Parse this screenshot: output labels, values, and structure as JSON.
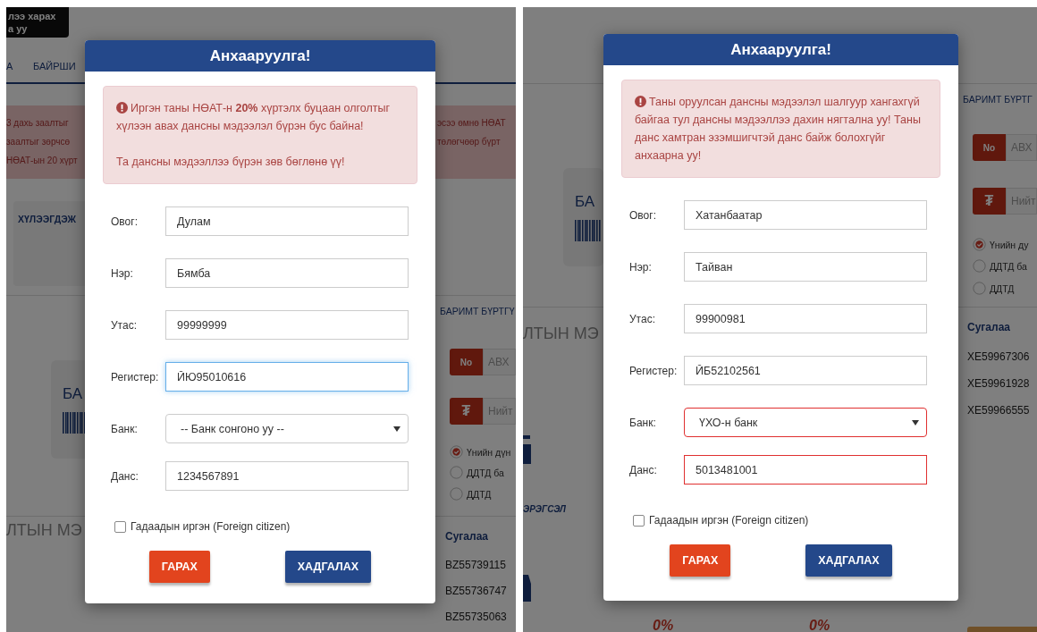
{
  "panels": [
    {
      "background": {
        "tooltip": [
          "лээ харах",
          "а уу"
        ],
        "nav": [
          "А",
          "БАЙРШИ"
        ],
        "notice_left": [
          "3 дахь заалтыг",
          "заалтыг  зөрчсө",
          "НӨАТ-ын 20 хүрт"
        ],
        "notice_right": [
          "эсээ өмнө НӨАТ",
          "төлөгчөөр  бүрт"
        ],
        "pending_card": "ХҮЛЭЭГДЭЖ",
        "receipt": "БА",
        "heading": "ЛТЫН МЭ",
        "side": {
          "title": "БАРИМТ БҮРТГҮ",
          "number_prefix": "No",
          "number_placeholder": "АВХ",
          "currency": "₮",
          "amount_placeholder": "Нийт",
          "options": [
            {
              "label": "Үнийн дүн",
              "selected": true
            },
            {
              "label": "ДДТД ба",
              "selected": false
            },
            {
              "label": "ДДТД",
              "selected": false
            }
          ],
          "lottery_header": "Сугалаа",
          "lottery": [
            "BZ55739115",
            "BZ55736747",
            "BZ55735063"
          ]
        }
      },
      "modal": {
        "title": "Анхааруулга!",
        "alert": [
          "Иргэн таны НӨАТ-н **20%** хүртэлх буцаан олголтыг хүлээн авах дансны мэдээлэл бүрэн бус байна!",
          "Та дансны мэдээллээ бүрэн зөв бөглөнө үү!"
        ],
        "fields": [
          {
            "kind": "text",
            "label": "Овог:",
            "value": "Дулам",
            "focused": false,
            "invalid": false
          },
          {
            "kind": "text",
            "label": "Нэр:",
            "value": "Бямба",
            "focused": false,
            "invalid": false
          },
          {
            "kind": "text",
            "label": "Утас:",
            "value": "99999999",
            "focused": false,
            "invalid": false
          },
          {
            "kind": "text",
            "label": "Регистер:",
            "value": "ЙЮ95010616",
            "focused": true,
            "invalid": false
          },
          {
            "kind": "select",
            "label": "Банк:",
            "value": "-- Банк сонгоно уу --",
            "focused": false,
            "invalid": false
          },
          {
            "kind": "text",
            "label": "Данс:",
            "value": "1234567891",
            "focused": false,
            "invalid": false
          }
        ],
        "checkbox": {
          "label": "Гадаадын иргэн (Foreign citizen)",
          "checked": false
        },
        "buttons": [
          {
            "kind": "cancel",
            "label": "ГАРАХ"
          },
          {
            "kind": "save",
            "label": "ХАДГАЛАХ"
          }
        ]
      }
    },
    {
      "background": {
        "receipt": "БА",
        "heading": "ЛТЫН МЭ",
        "category": "ЭРЭГСЭЛ",
        "percents": [
          "0%",
          "0%"
        ],
        "side": {
          "title": "БАРИМТ БҮРТГ",
          "number_prefix": "No",
          "number_placeholder": "АВХ",
          "currency": "₮",
          "amount_placeholder": "Нийт",
          "options": [
            {
              "label": "Үнийн ду",
              "selected": true
            },
            {
              "label": "ДДТД ба",
              "selected": false
            },
            {
              "label": "ДДТД",
              "selected": false
            }
          ],
          "lottery_header": "Сугалаа",
          "lottery": [
            "XE59967306",
            "XE59961928",
            "XE59966555"
          ],
          "pending_button": true
        }
      },
      "modal": {
        "title": "Анхааруулга!",
        "alert": [
          "Таны оруулсан дансны мэдээлэл шалгуур хангахгүй байгаа тул дансны мэдээллээ дахин нягтална уу! Таны данс хамтран эзэмшигчтэй данс байж болохгүйг анхаарна уу!"
        ],
        "fields": [
          {
            "kind": "text",
            "label": "Овог:",
            "value": "Хатанбаатар",
            "focused": false,
            "invalid": false
          },
          {
            "kind": "text",
            "label": "Нэр:",
            "value": "Тайван",
            "focused": false,
            "invalid": false
          },
          {
            "kind": "text",
            "label": "Утас:",
            "value": "99900981",
            "focused": false,
            "invalid": false
          },
          {
            "kind": "text",
            "label": "Регистер:",
            "value": "ЙБ52102561",
            "focused": false,
            "invalid": false
          },
          {
            "kind": "select",
            "label": "Банк:",
            "value": "ҮХО-н банк",
            "focused": false,
            "invalid": true
          },
          {
            "kind": "text",
            "label": "Данс:",
            "value": "5013481001",
            "focused": false,
            "invalid": true
          }
        ],
        "checkbox": {
          "label": "Гадаадын иргэн (Foreign citizen)",
          "checked": false
        },
        "buttons": [
          {
            "kind": "cancel",
            "label": "ГАРАХ"
          },
          {
            "kind": "save",
            "label": "ХАДГАЛАХ"
          }
        ]
      }
    }
  ]
}
